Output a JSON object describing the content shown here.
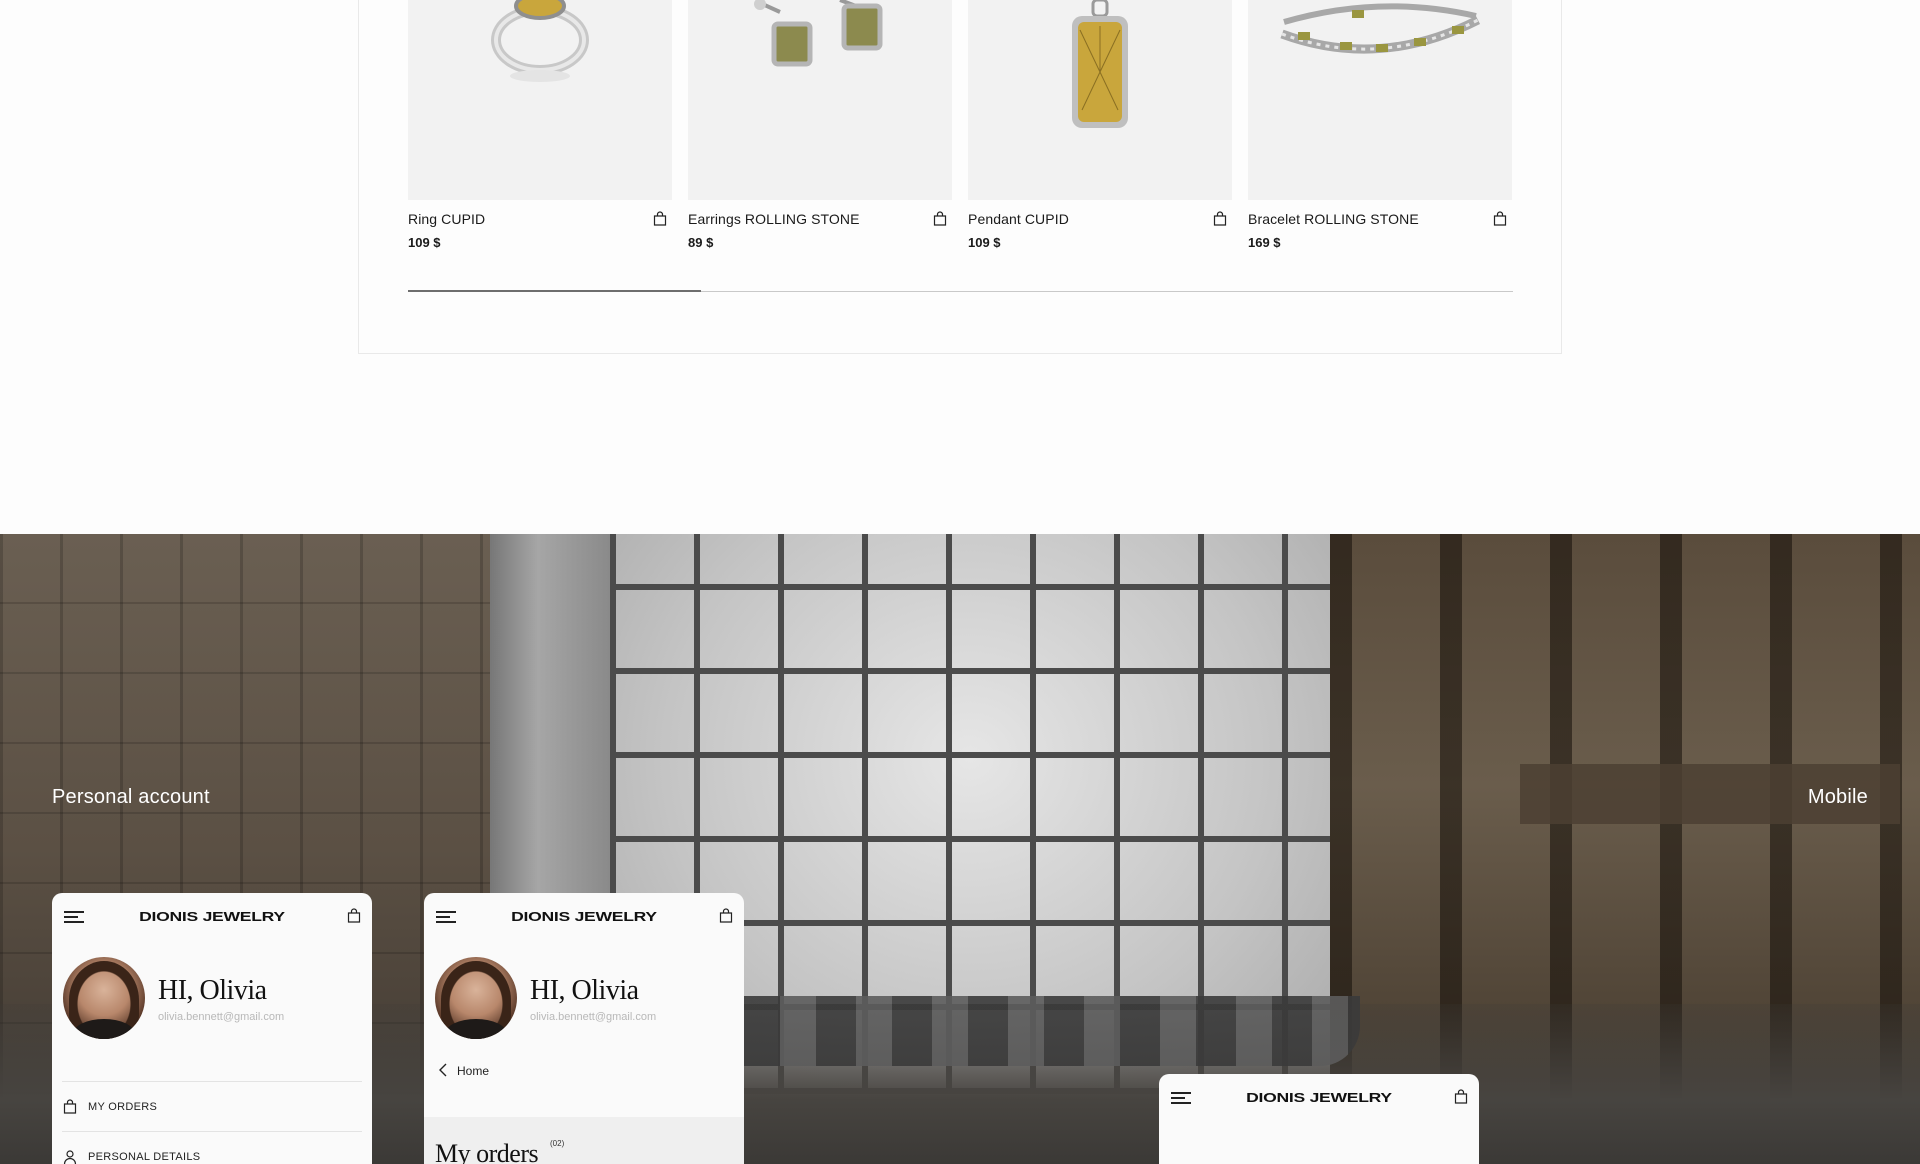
{
  "products": [
    {
      "name": "Ring CUPID",
      "price": "109 $",
      "image": "silver-ring-gold-signet"
    },
    {
      "name": "Earrings ROLLING STONE",
      "price": "89 $",
      "image": "silver-stud-earrings-olive-stone"
    },
    {
      "name": "Pendant CUPID",
      "price": "109 $",
      "image": "silver-pendant-gold-tag"
    },
    {
      "name": "Bracelet ROLLING STONE",
      "price": "169 $",
      "image": "silver-tennis-bracelet-olive-stones"
    }
  ],
  "slider": {
    "progress": 0.265
  },
  "banner": {
    "left_label": "Personal account",
    "right_label": "Mobile"
  },
  "mockups": {
    "brand": "DIONIS JEWELRY",
    "greeting": "HI, Olivia",
    "email": "olivia.bennett@gmail.com",
    "menu": [
      "MY ORDERS",
      "PERSONAL DETAILS"
    ],
    "back_label": "Home",
    "orders_title": "My orders",
    "orders_count": "(02)"
  },
  "icons": [
    "shopping-bag-icon",
    "hamburger-menu-icon",
    "user-icon",
    "chevron-left-icon"
  ],
  "colors": {
    "page_bg": "#fdfdfd",
    "card_bg": "#f2f2f2",
    "text": "#1a1a1a",
    "muted": "#b8b8b8",
    "slider_thumb": "#6e6e6e"
  }
}
